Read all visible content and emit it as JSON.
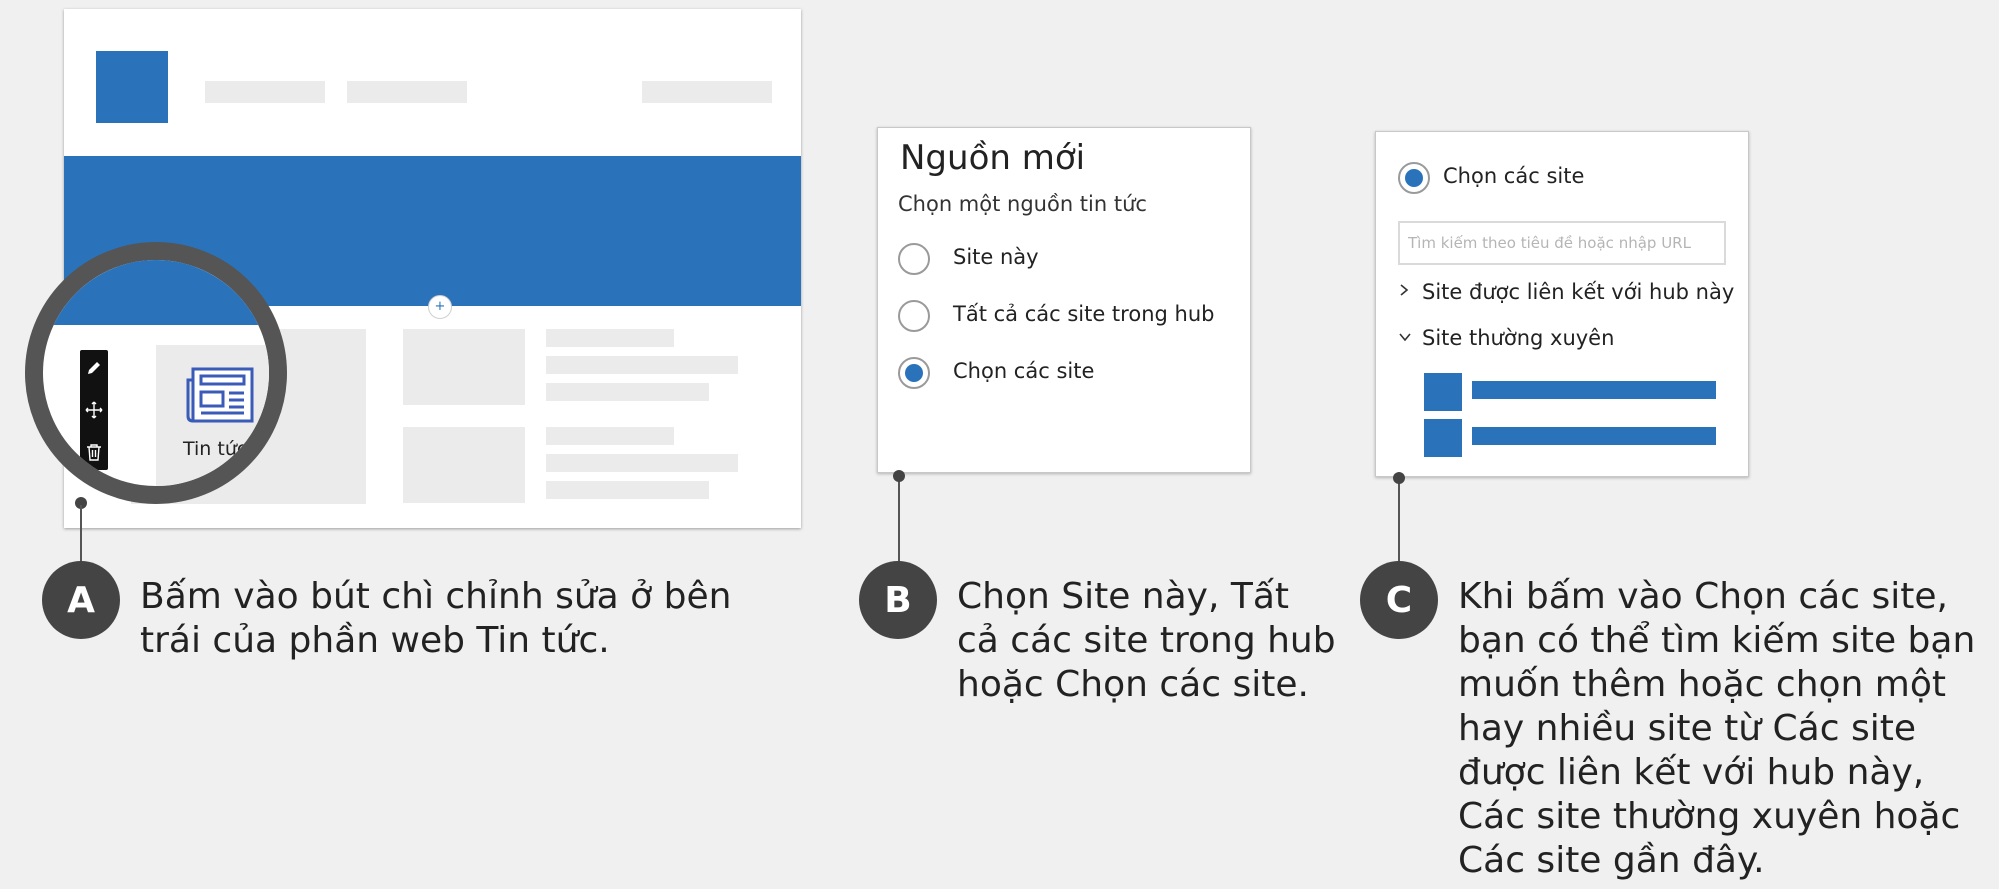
{
  "steps": [
    {
      "letter": "A",
      "text": "Bấm vào bút chì chỉnh sửa ở bên trái của phần web Tin tức."
    },
    {
      "letter": "B",
      "text": "Chọn Site này, Tất cả các site trong hub hoặc Chọn các site."
    },
    {
      "letter": "C",
      "text": "Khi bấm vào Chọn các site, bạn có thể tìm kiếm site bạn muốn thêm hoặc chọn một hay nhiều site từ Các site được liên kết với hub này, Các site thường xuyên hoặc Các site gần đây."
    }
  ],
  "panel_a": {
    "news_label": "Tin tức",
    "add_symbol": "+",
    "toolbar_icons": [
      "pencil-icon",
      "move-icon",
      "trash-icon"
    ],
    "webpart_icon": "newspaper-icon"
  },
  "panel_b": {
    "title": "Nguồn mới",
    "subtitle": "Chọn một nguồn tin tức",
    "options": [
      {
        "label": "Site này",
        "selected": false
      },
      {
        "label": "Tất cả các site trong hub",
        "selected": false
      },
      {
        "label": "Chọn các site",
        "selected": true
      }
    ]
  },
  "panel_c": {
    "selected_option": "Chọn các site",
    "search_placeholder": "Tìm kiếm theo tiêu đề hoặc nhập URL",
    "tree": [
      {
        "label": "Site được liên kết với hub này",
        "expanded": false
      },
      {
        "label": "Site thường xuyên",
        "expanded": true
      }
    ]
  },
  "colors": {
    "accent_blue": "#2a73bb",
    "badge_grey": "#444444",
    "background": "#f0f0f0",
    "placeholder_grey": "#ebebeb"
  }
}
